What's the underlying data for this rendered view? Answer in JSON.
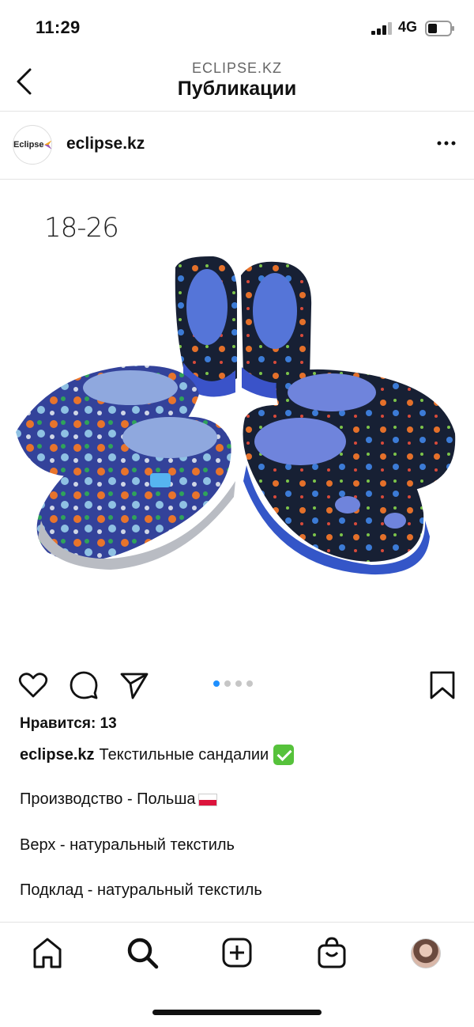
{
  "status": {
    "time": "11:29",
    "network": "4G"
  },
  "header": {
    "account": "ECLIPSE.KZ",
    "title": "Публикации"
  },
  "post": {
    "avatar_label": "Eclipse",
    "username": "eclipse.kz",
    "image_overlay_text": "18-26",
    "carousel": {
      "count": 4,
      "active": 1
    },
    "likes": "Нравится: 13",
    "caption_user": "eclipse.kz",
    "caption_text": "Текстильные сандалии",
    "lines": [
      "Производство - Польша",
      "Верх - натуральный текстиль",
      "Подклад - натуральный текстиль"
    ]
  },
  "icons": {
    "back": "chevron-left-icon",
    "more": "more-horizontal-icon",
    "like": "heart-icon",
    "comment": "comment-icon",
    "share": "send-icon",
    "save": "bookmark-icon",
    "home": "home-icon",
    "search": "search-icon",
    "create": "plus-square-icon",
    "shop": "shopping-bag-icon"
  },
  "colors": {
    "carousel_active": "#1e90ff",
    "check": "#56c23b"
  }
}
